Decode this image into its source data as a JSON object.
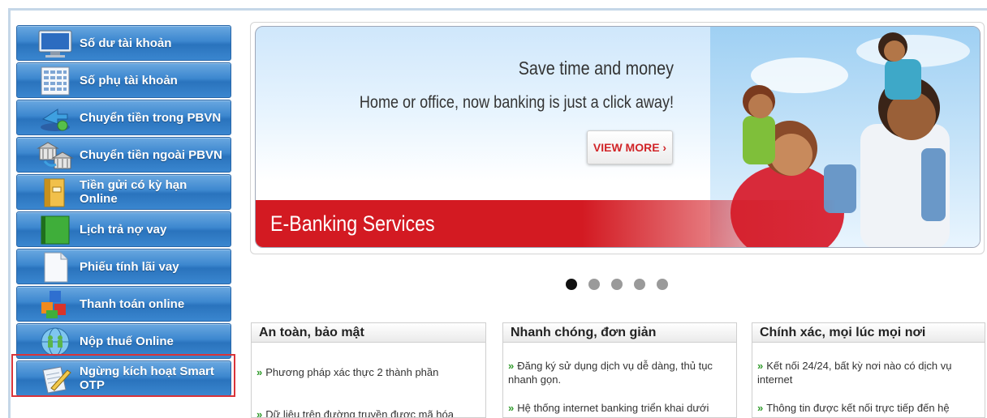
{
  "sidebar": {
    "items": [
      {
        "label": "Số dư tài khoản",
        "icon": "monitor-icon"
      },
      {
        "label": "Số phụ tài khoản",
        "icon": "ledger-icon"
      },
      {
        "label": "Chuyển tiền trong PBVN",
        "icon": "transfer-arrows-icon"
      },
      {
        "label": "Chuyển tiền ngoài PBVN",
        "icon": "bank-building-icon"
      },
      {
        "label": "Tiền gửi có kỳ hạn Online",
        "icon": "binder-icon"
      },
      {
        "label": "Lịch trả nợ vay",
        "icon": "green-book-icon"
      },
      {
        "label": "Phiếu tính lãi vay",
        "icon": "document-icon"
      },
      {
        "label": "Thanh toán online",
        "icon": "colored-blocks-icon"
      },
      {
        "label": "Nộp thuế Online",
        "icon": "globe-people-icon"
      },
      {
        "label": "Ngừng kích hoạt Smart OTP",
        "icon": "pen-paper-icon"
      }
    ]
  },
  "banner": {
    "headline": "Save time and money",
    "subline": "Home or office, now banking is just a click away!",
    "button_label": "VIEW MORE  ›",
    "bar_text": "E-Banking Services"
  },
  "carousel": {
    "slides": 5,
    "active": 1
  },
  "panels": [
    {
      "title": "An toàn, bảo mật",
      "items": [
        "Phương pháp xác thực 2 thành phần",
        "Dữ liệu trên đường truyền được mã hóa"
      ]
    },
    {
      "title": "Nhanh chóng, đơn giản",
      "items": [
        "Đăng ký sử dụng dịch vụ dễ dàng, thủ tục nhanh gọn.",
        "Hệ thống internet banking triển khai dưới dạng website, tiện lợi cho việc"
      ]
    },
    {
      "title": "Chính xác, mọi lúc mọi nơi",
      "items": [
        "Kết nối 24/24, bất kỳ nơi nào có dịch vụ internet",
        "Thông tin được kết nối trực tiếp đến hệ thống ngân hàng"
      ]
    }
  ],
  "colors": {
    "menu_blue": "#3a86cf",
    "banner_red": "#d31a22",
    "highlight_red": "#d9343a",
    "bullet_green": "#2f9a2a"
  }
}
